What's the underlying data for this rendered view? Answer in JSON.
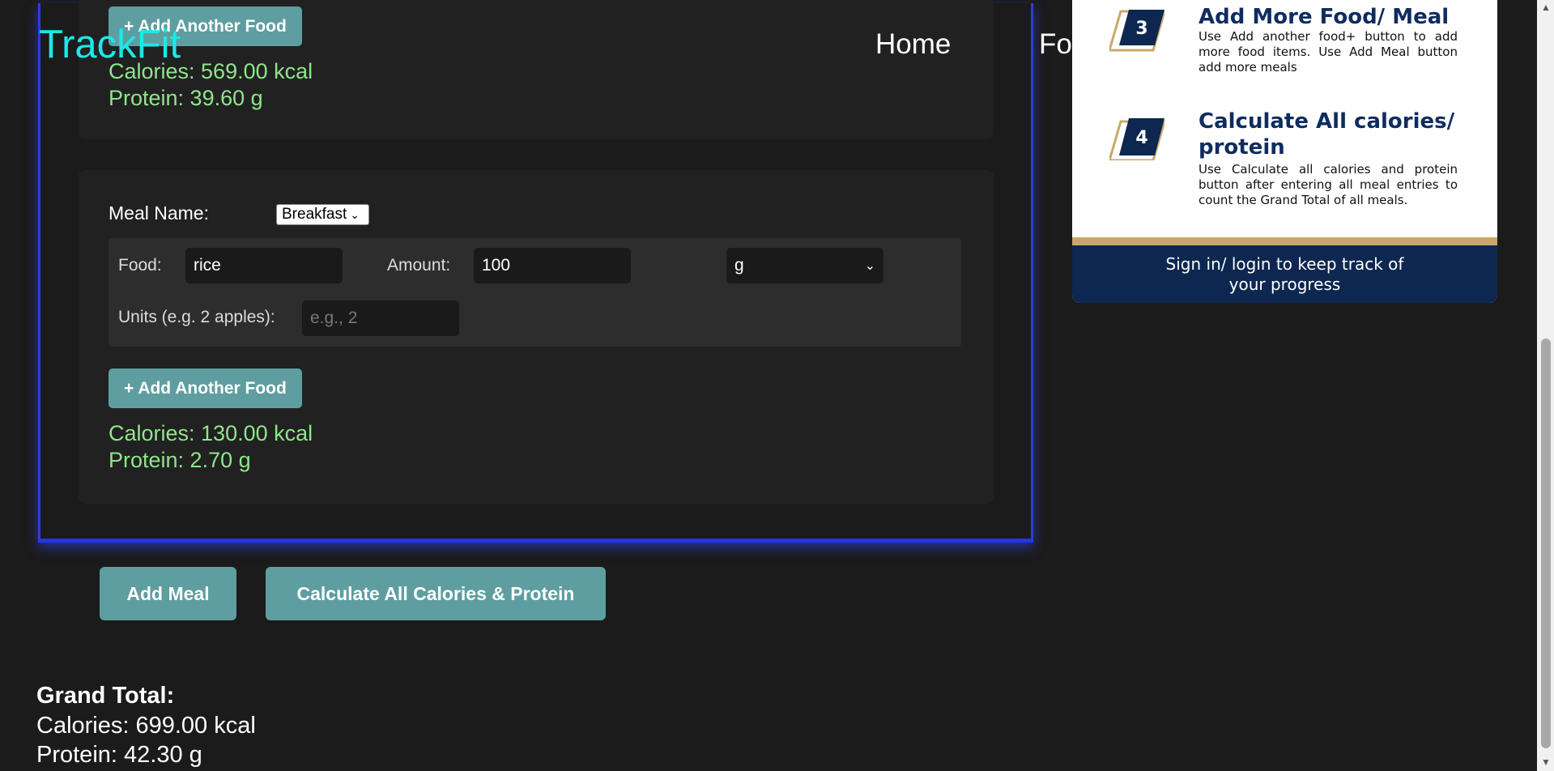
{
  "nav": {
    "logo": "TrackFit",
    "links": [
      "Home",
      "Fo"
    ]
  },
  "meals": [
    {
      "add_food_label": "+ Add Another Food",
      "calories": "Calories: 569.00 kcal",
      "protein": "Protein: 39.60 g"
    },
    {
      "meal_name_label": "Meal Name:",
      "meal_name_value": "Breakfast",
      "food_label": "Food:",
      "food_value": "rice",
      "amount_label": "Amount:",
      "amount_value": "100",
      "unit_value": "g",
      "units_label": "Units (e.g. 2 apples):",
      "units_placeholder": "e.g., 2",
      "add_food_label": "+ Add Another Food",
      "calories": "Calories: 130.00 kcal",
      "protein": "Protein: 2.70 g"
    }
  ],
  "actions": {
    "add_meal": "Add Meal",
    "calculate": "Calculate All Calories & Protein"
  },
  "grand_total": {
    "title": "Grand Total:",
    "calories": "Calories: 699.00 kcal",
    "protein": "Protein: 42.30 g"
  },
  "guide": {
    "steps": [
      {
        "num": "3",
        "title": "Add More Food/ Meal",
        "desc": "Use Add another food+ button to add more food items. Use Add Meal button add more meals"
      },
      {
        "num": "4",
        "title": "Calculate All calories/ protein",
        "desc": "Use Calculate all calories and protein button after entering all meal entries to count the Grand Total of all meals."
      }
    ],
    "footer": "Sign in/ login to keep track of your progress"
  },
  "colors": {
    "accent": "#5f9ea0",
    "logo": "#1ce8e8",
    "nutrition": "#8fe68b",
    "panel_glow": "#2b3ed8",
    "guide_navy": "#0d2750",
    "guide_gold": "#c8a86a"
  },
  "icons": [
    "chevron-down-icon",
    "step-badge-icon"
  ]
}
